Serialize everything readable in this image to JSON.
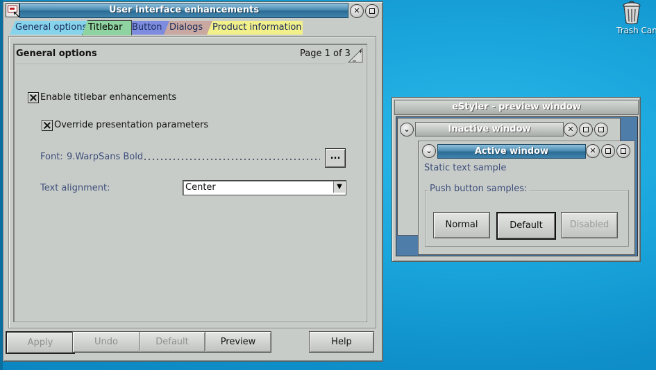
{
  "desktop": {
    "trash_label": "Trash Can"
  },
  "main_window": {
    "title": "User interface enhancements",
    "tabs": [
      {
        "label": "General options",
        "color": "#86d4ec"
      },
      {
        "label": "Titlebar",
        "color": "#8fd3a0",
        "selected": true
      },
      {
        "label": "Button",
        "color": "#7e8ce0"
      },
      {
        "label": "Dialogs",
        "color": "#c8a8a0"
      },
      {
        "label": "Product information",
        "color": "#f2f08a"
      }
    ],
    "page": {
      "title": "General options",
      "page_indicator": "Page 1 of 3"
    },
    "enable_titlebar": {
      "label": "Enable titlebar enhancements",
      "checked": true
    },
    "override_params": {
      "label": "Override presentation parameters",
      "checked": true
    },
    "font": {
      "label": "Font:",
      "value": "9.WarpSans Bold",
      "button_label": "..."
    },
    "text_alignment": {
      "label": "Text alignment:",
      "value": "Center"
    },
    "buttons": {
      "apply": "Apply",
      "undo": "Undo",
      "default": "Default",
      "preview": "Preview",
      "help": "Help"
    }
  },
  "preview_window": {
    "title": "eStyler - preview window",
    "inactive_title": "Inactive window",
    "active_title": "Active window",
    "static_text": "Static text sample",
    "group_title": "Push button samples:",
    "buttons": {
      "normal": "Normal",
      "default": "Default",
      "disabled": "Disabled"
    }
  }
}
